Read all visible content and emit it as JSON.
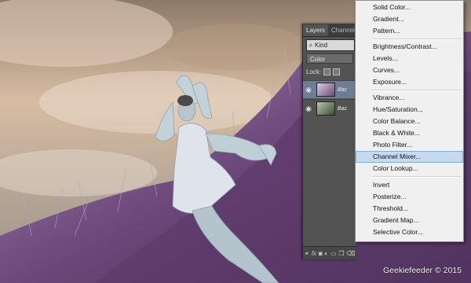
{
  "layers_panel": {
    "tabs": [
      "Layers",
      "Channels"
    ],
    "kind_filter": "Kind",
    "blend_mode": "Color",
    "lock_label": "Lock:",
    "layers": [
      {
        "name": "Bac",
        "selected": true
      },
      {
        "name": "Bac",
        "selected": false
      }
    ],
    "bottom_icons": [
      "link-icon",
      "fx-icon",
      "mask-icon",
      "adjustment-icon",
      "folder-icon",
      "new-layer-icon",
      "trash-icon"
    ]
  },
  "adjustment_menu": {
    "items": [
      "Solid Color...",
      "Gradient...",
      "Pattern...",
      "Brightness/Contrast...",
      "Levels...",
      "Curves...",
      "Exposure...",
      "Vibrance...",
      "Hue/Saturation...",
      "Color Balance...",
      "Black & White...",
      "Photo Filter...",
      "Channel Mixer...",
      "Color Lookup...",
      "Invert",
      "Posterize...",
      "Threshold...",
      "Gradient Map...",
      "Selective Color..."
    ],
    "highlighted": "Channel Mixer..."
  },
  "watermark": "Geekiefeeder © 2015",
  "colors": {
    "menu_highlight": "#c5d9f1",
    "panel_bg": "#535353",
    "grass": "#7a4d86",
    "sky": "#c9b09a"
  }
}
